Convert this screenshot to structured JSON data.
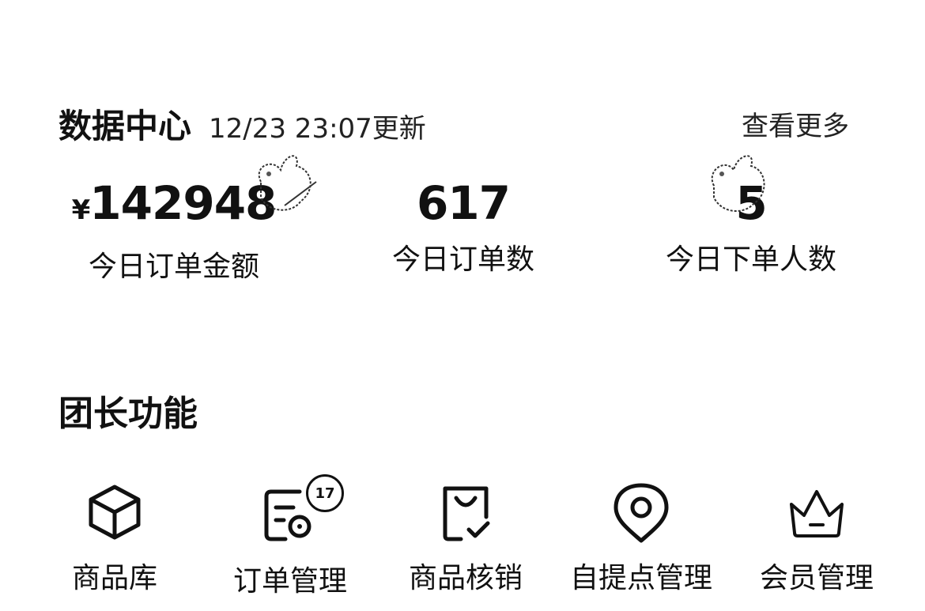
{
  "data_center": {
    "title": "数据中心",
    "update_time": "12/23 23:07更新",
    "view_more": "查看更多",
    "stats": [
      {
        "currency": "¥",
        "value": "142948",
        "label": "今日订单金额"
      },
      {
        "value": "617",
        "label": "今日订单数"
      },
      {
        "value": "5",
        "label": "今日下单人数"
      }
    ]
  },
  "functions": {
    "title": "团长功能",
    "items": [
      {
        "label": "商品库",
        "icon": "cube-icon"
      },
      {
        "label": "订单管理",
        "icon": "order-icon",
        "badge": "17"
      },
      {
        "label": "商品核销",
        "icon": "bag-check-icon"
      },
      {
        "label": "自提点管理",
        "icon": "location-pin-icon"
      },
      {
        "label": "会员管理",
        "icon": "crown-icon"
      }
    ]
  }
}
